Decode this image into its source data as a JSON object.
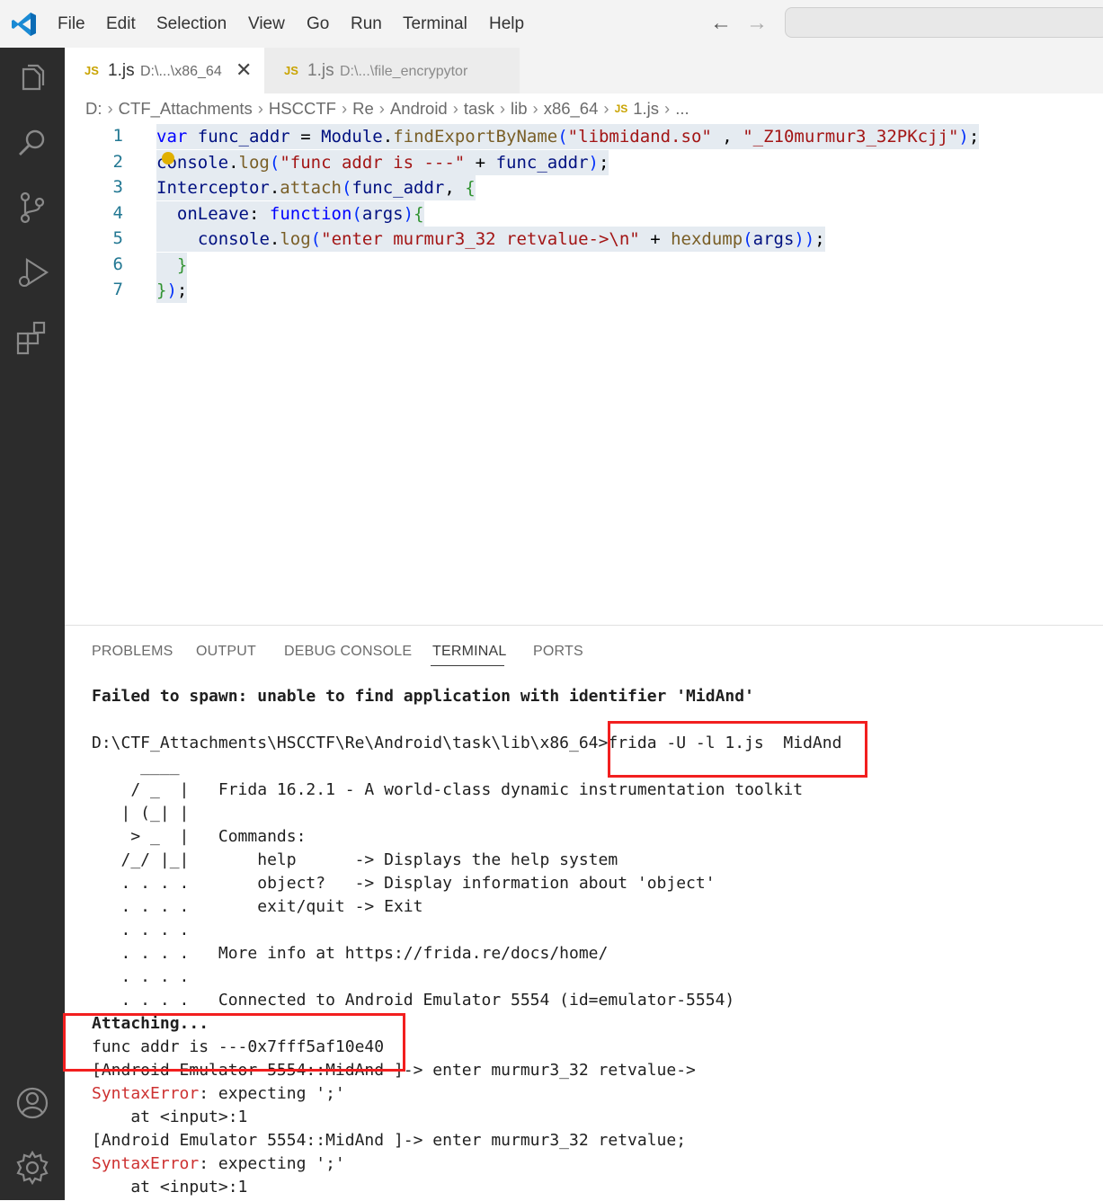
{
  "titlebar": {
    "menu": [
      "File",
      "Edit",
      "Selection",
      "View",
      "Go",
      "Run",
      "Terminal",
      "Help"
    ],
    "back_icon": "arrow-left-icon",
    "forward_icon": "arrow-right-icon"
  },
  "activitybar": {
    "icons": [
      "explorer-icon",
      "search-icon",
      "source-control-icon",
      "run-debug-icon",
      "extensions-icon",
      "account-icon",
      "settings-gear-icon"
    ]
  },
  "tabs": [
    {
      "badge": "JS",
      "name": "1.js",
      "path": "D:\\...\\x86_64",
      "active": true
    },
    {
      "badge": "JS",
      "name": "1.js",
      "path": "D:\\...\\file_encrypytor",
      "active": false
    }
  ],
  "breadcrumb": {
    "items": [
      "D:",
      "CTF_Attachments",
      "HSCCTF",
      "Re",
      "Android",
      "task",
      "lib",
      "x86_64"
    ],
    "file_badge": "JS",
    "file": "1.js",
    "ellipsis": "..."
  },
  "editor": {
    "line_numbers": [
      "1",
      "2",
      "3",
      "4",
      "5",
      "6",
      "7"
    ],
    "lines": [
      "var func_addr = Module.findExportByName(\"libmidand.so\" , \"_Z10murmur3_32PKcjj\");",
      "console.log(\"func addr is ---\" + func_addr);",
      "Interceptor.attach(func_addr, {",
      "  onLeave: function(args){",
      "    console.log(\"enter murmur3_32 retvalue->\\n\" + hexdump(args));",
      "  }",
      "});"
    ]
  },
  "panel": {
    "tabs": [
      "PROBLEMS",
      "OUTPUT",
      "DEBUG CONSOLE",
      "TERMINAL",
      "PORTS"
    ],
    "active_tab": "TERMINAL"
  },
  "terminal": {
    "line_spawn_fail": "Failed to spawn: unable to find application with identifier 'MidAnd'",
    "prompt": "D:\\CTF_Attachments\\HSCCTF\\Re\\Android\\task\\lib\\x86_64>",
    "command": "frida -U -l 1.js  MidAnd",
    "banner": [
      "     ____",
      "    / _  |   Frida 16.2.1 - A world-class dynamic instrumentation toolkit",
      "   | (_| |",
      "    > _  |   Commands:",
      "   /_/ |_|       help      -> Displays the help system",
      "   . . . .       object?   -> Display information about 'object'",
      "   . . . .       exit/quit -> Exit",
      "   . . . .",
      "   . . . .   More info at https://frida.re/docs/home/",
      "   . . . .",
      "   . . . .   Connected to Android Emulator 5554 (id=emulator-5554)"
    ],
    "attaching": "Attaching...",
    "func_addr_line": "func addr is ---0x7fff5af10e40",
    "session_line_1": "[Android Emulator 5554::MidAnd ]-> enter murmur3_32 retvalue->",
    "error_name": "SyntaxError",
    "error_rest": ": expecting ';'",
    "at_input": "    at <input>:1",
    "session_line_2": "[Android Emulator 5554::MidAnd ]-> enter murmur3_32 retvalue;"
  },
  "colors": {
    "activitybar_bg": "#2c2c2c",
    "highlight_box": "#f21f1f",
    "error_red": "#cd3131",
    "js_badge": "#c9a300"
  }
}
